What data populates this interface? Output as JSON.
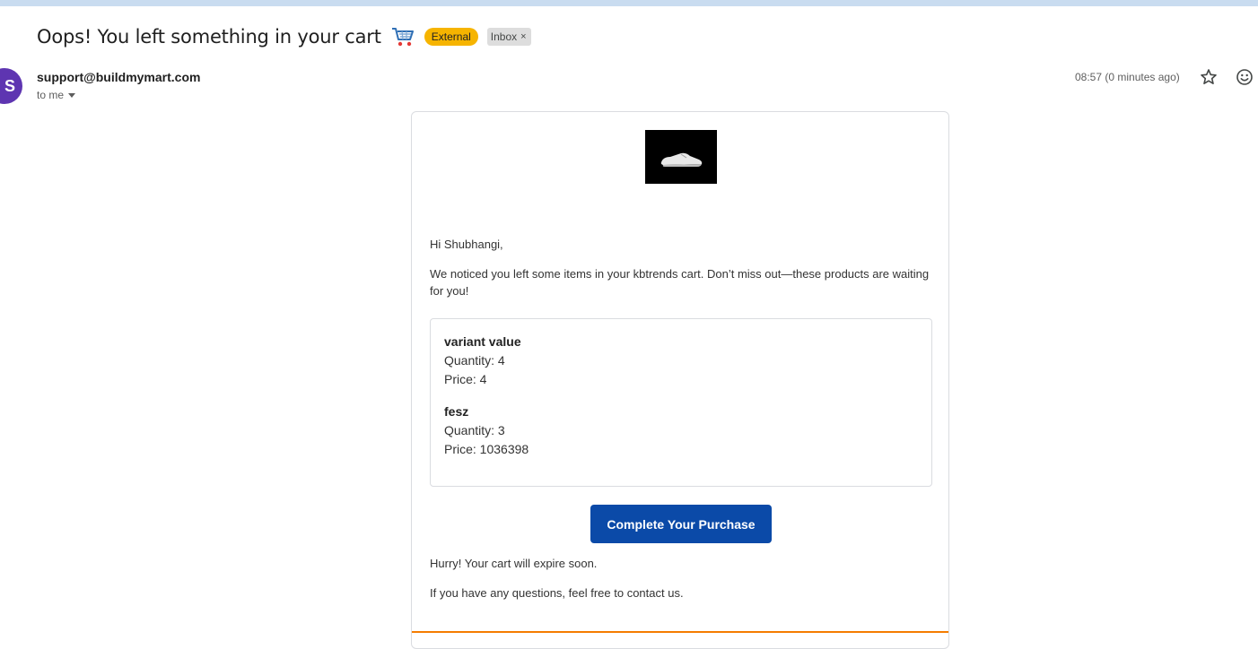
{
  "email": {
    "subject": "Oops! You left something in your cart",
    "subject_icon": "shopping-cart-icon",
    "labels": {
      "external": "External",
      "inbox": "Inbox",
      "inbox_remove": "×"
    },
    "sender": {
      "avatar_letter": "S",
      "avatar_color": "#5e35b1",
      "address": "support@buildmymart.com",
      "recipient": "to me"
    },
    "timestamp": "08:57 (0 minutes ago)",
    "actions": [
      "star-icon",
      "emoji-icon"
    ]
  },
  "message": {
    "logo_icon": "sneaker-image",
    "greeting": "Hi Shubhangi,",
    "notice": "We noticed you left some items in your kbtrends cart. Don’t miss out—these products are waiting for you!",
    "items": [
      {
        "name": "variant value",
        "quantity": "Quantity: 4",
        "price": "Price: 4"
      },
      {
        "name": "fesz",
        "quantity": "Quantity: 3",
        "price": "Price: 1036398"
      }
    ],
    "cta_label": "Complete Your Purchase",
    "cta_color": "#0b4aa8",
    "hurry": "Hurry! Your cart will expire soon.",
    "contact": "If you have any questions, feel free to contact us.",
    "accent_color": "#f57c00"
  }
}
